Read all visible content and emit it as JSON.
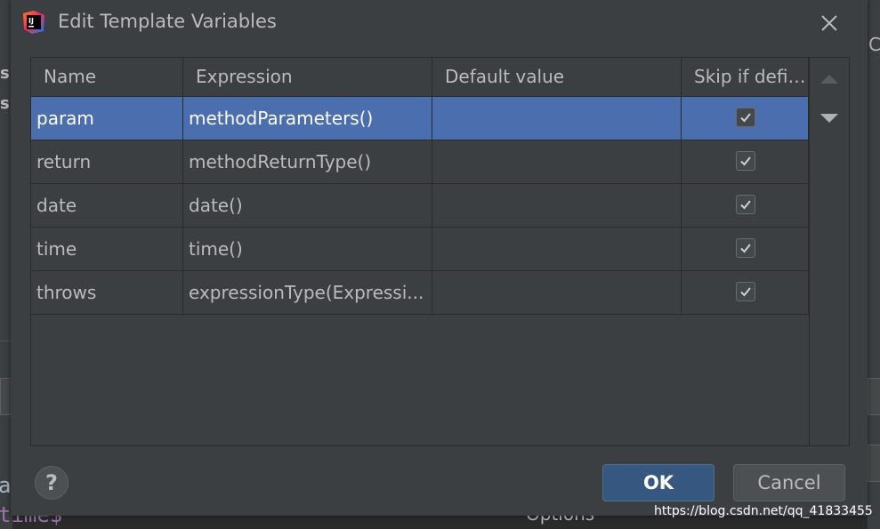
{
  "background": {
    "left_letters": [
      "s",
      "s"
    ],
    "right_glyph": "C",
    "code_line_1": "ar",
    "code_line_2": "time$",
    "options_label": "Options"
  },
  "dialog": {
    "title": "Edit Template Variables",
    "app_icon": "intellij-idea-icon",
    "columns": [
      "Name",
      "Expression",
      "Default value",
      "Skip if defin..."
    ],
    "rows": [
      {
        "name": "param",
        "expression": "methodParameters()",
        "default_value": "",
        "skip": true,
        "selected": true
      },
      {
        "name": "return",
        "expression": "methodReturnType()",
        "default_value": "",
        "skip": true,
        "selected": false
      },
      {
        "name": "date",
        "expression": "date()",
        "default_value": "",
        "skip": true,
        "selected": false
      },
      {
        "name": "time",
        "expression": "time()",
        "default_value": "",
        "skip": true,
        "selected": false
      },
      {
        "name": "throws",
        "expression": "expressionType(Expressi...",
        "default_value": "",
        "skip": true,
        "selected": false
      }
    ],
    "help_label": "?",
    "ok_label": "OK",
    "cancel_label": "Cancel"
  },
  "watermark": "https://blog.csdn.net/qq_41833455",
  "colors": {
    "dialog_bg": "#3c3f41",
    "selection": "#4b6eaf",
    "ok_button": "#365880",
    "text": "#bbbbbb"
  }
}
